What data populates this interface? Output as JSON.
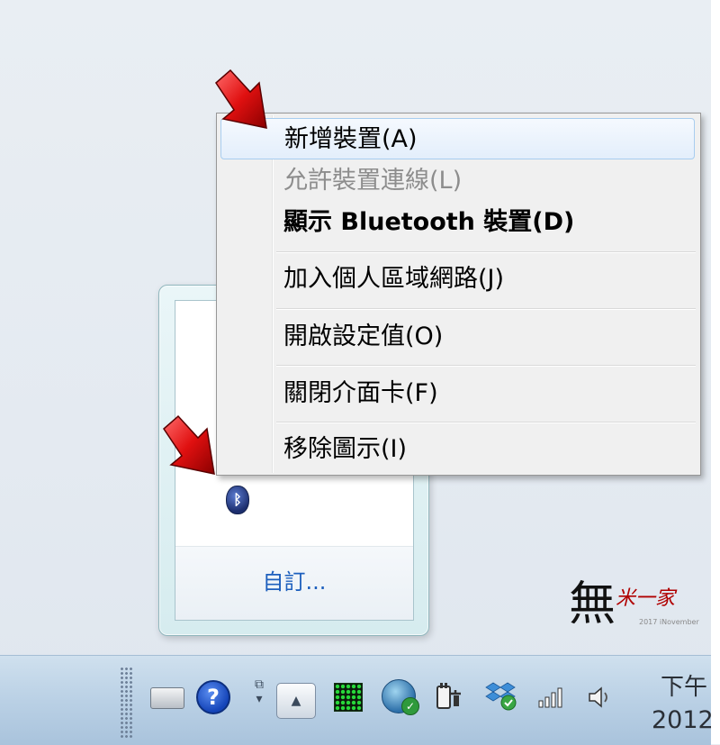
{
  "context_menu": {
    "items": [
      {
        "label": "新增裝置(A)",
        "state": "highlighted"
      },
      {
        "label": "允許裝置連線(L)",
        "state": "disabled"
      },
      {
        "label": "顯示 Bluetooth 裝置(D)",
        "state": "default"
      },
      {
        "label": "加入個人區域網路(J)",
        "state": "normal"
      },
      {
        "label": "開啟設定值(O)",
        "state": "normal"
      },
      {
        "label": "關閉介面卡(F)",
        "state": "normal"
      },
      {
        "label": "移除圖示(I)",
        "state": "normal"
      }
    ]
  },
  "tray_overflow": {
    "customize_label": "自訂...",
    "icons": [
      "monitor-app-icon",
      "photo-gallery-icon",
      "bluetooth-icon"
    ]
  },
  "taskbar": {
    "icons": [
      "keyboard-icon",
      "help-icon",
      "window-switch-icon",
      "show-hidden-icons-button",
      "green-meter-icon",
      "network-globe-icon",
      "power-plug-icon",
      "dropbox-icon",
      "signal-bars-icon",
      "speaker-icon"
    ],
    "clock_line1": "下午",
    "clock_line2": "2012"
  },
  "watermark": {
    "signature": "無",
    "name": "米一家",
    "caption": "2017 iNovember"
  },
  "colors": {
    "menu_bg": "#f0f0f0",
    "highlight_border": "#a8cdef",
    "link_blue": "#1d5fbd",
    "arrow_red": "#d81616"
  }
}
